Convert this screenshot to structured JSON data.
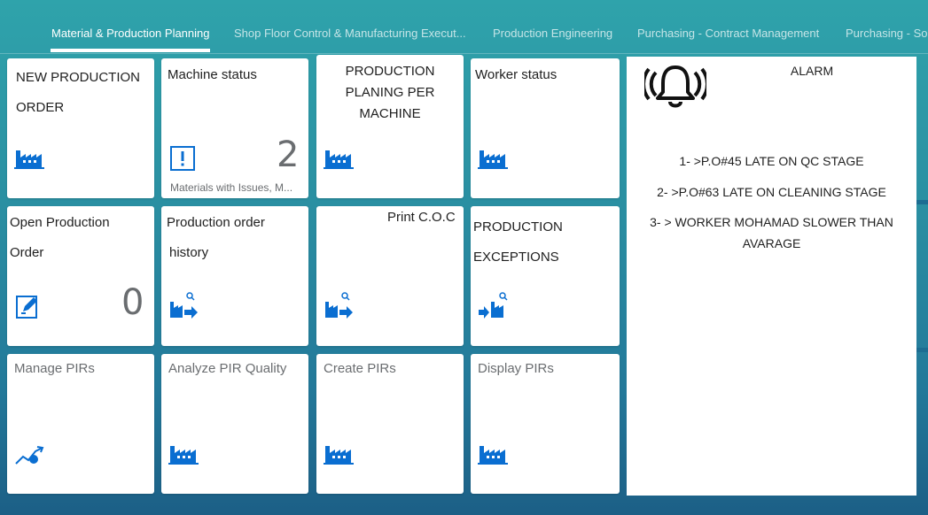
{
  "tabs": [
    {
      "label": "Material & Production Planning",
      "active": true
    },
    {
      "label": "Shop Floor Control & Manufacturing Execut..."
    },
    {
      "label": "Production Engineering"
    },
    {
      "label": "Purchasing - Contract Management"
    },
    {
      "label": "Purchasing - So"
    }
  ],
  "tiles": {
    "new_order": {
      "line1": "NEW PRODUCTION",
      "line2": "ORDER",
      "icon": "factory-icon"
    },
    "machine_status": {
      "title": "Machine status",
      "number": "2",
      "subtitle": "Materials with Issues, M...",
      "icon": "alert-icon"
    },
    "planning": {
      "line1": "PRODUCTION",
      "line2": "PLANING PER",
      "line3": "MACHINE",
      "icon": "factory-icon"
    },
    "worker_status": {
      "title": "Worker status",
      "icon": "factory-icon"
    },
    "open_order": {
      "line1": "Open Production",
      "line2": "Order",
      "number": "0",
      "icon": "edit-icon"
    },
    "order_history": {
      "line1": "Production order",
      "line2": "history",
      "icon": "factory-search-icon"
    },
    "print_coc": {
      "title": "Print C.O.C",
      "icon": "factory-search-icon"
    },
    "exceptions": {
      "line1": "PRODUCTION",
      "line2": "EXCEPTIONS",
      "icon": "factory-search-in-icon"
    },
    "manage_pirs": {
      "title": "Manage PIRs",
      "icon": "trend-icon"
    },
    "analyze_pir": {
      "title": "Analyze PIR Quality",
      "icon": "factory-icon"
    },
    "create_pirs": {
      "title": "Create PIRs",
      "icon": "factory-icon"
    },
    "display_pirs": {
      "title": "Display PIRs",
      "icon": "factory-icon"
    }
  },
  "alarm": {
    "title": "ALARM",
    "icon": "bell-icon",
    "items": [
      "1- >P.O#45 LATE ON QC STAGE",
      "2- >P.O#63 LATE ON CLEANING STAGE",
      "3- > WORKER MOHAMAD SLOWER THAN",
      "AVARAGE"
    ]
  },
  "colors": {
    "accent": "#0a6ed1",
    "background_top": "#2fa3ab",
    "background_bottom": "#1c5f86"
  }
}
